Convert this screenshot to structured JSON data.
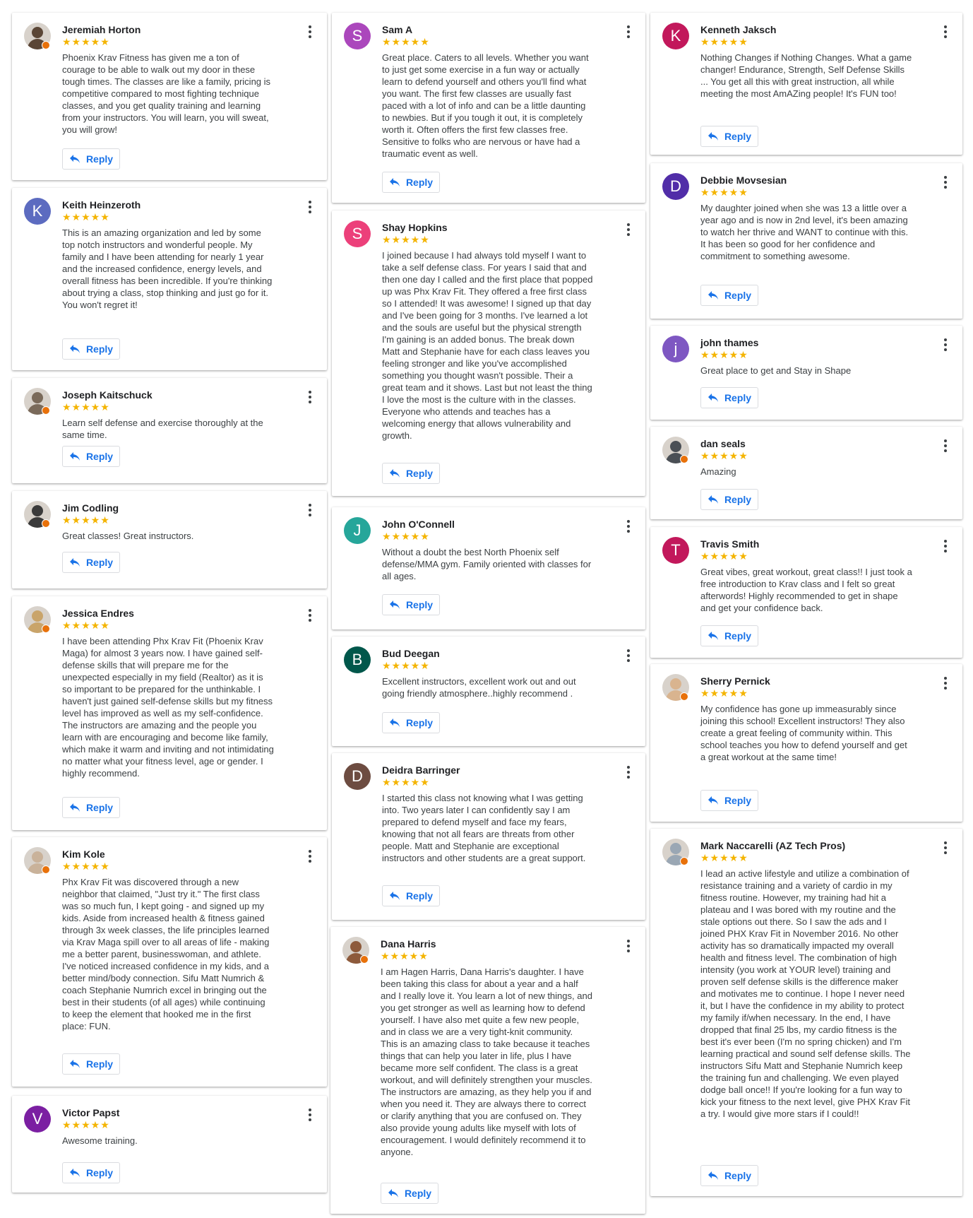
{
  "reviews": [
    {
      "name": "Jeremiah Horton",
      "stars": "★★★★★",
      "avatar_type": "photo",
      "avatar_letter": "",
      "avatar_color": "#5b4636",
      "text": "Phoenix Krav Fitness has given me a ton of courage to be able to walk out my door in these tough times. The classes are like a family, pricing is competitive compared to most fighting technique classes, and you get quality training and learning from your instructors. You will learn, you will sweat, you will grow!",
      "reply": "Reply"
    },
    {
      "name": "Keith Heinzeroth",
      "stars": "★★★★★",
      "avatar_type": "letter",
      "avatar_letter": "K",
      "avatar_color": "#5c6bc0",
      "text": "This is an amazing organization and led by some top notch instructors and wonderful people. My family and I have been attending for nearly 1 year and the increased confidence, energy levels, and overall fitness has been incredible. If you're thinking about trying a class, stop thinking and just go for it. You won't regret it!",
      "reply": "Reply"
    },
    {
      "name": "Joseph Kaitschuck",
      "stars": "★★★★★",
      "avatar_type": "photo",
      "avatar_letter": "",
      "avatar_color": "#7a6a5a",
      "text": "Learn self defense and exercise thoroughly at the same time.",
      "reply": "Reply"
    },
    {
      "name": "Jim Codling",
      "stars": "★★★★★",
      "avatar_type": "photo",
      "avatar_letter": "",
      "avatar_color": "#3b3b3b",
      "text": "Great classes! Great instructors.",
      "reply": "Reply"
    },
    {
      "name": "Jessica Endres",
      "stars": "★★★★★",
      "avatar_type": "photo",
      "avatar_letter": "",
      "avatar_color": "#c9a46a",
      "text": "I have been attending Phx Krav Fit (Phoenix Krav Maga) for almost 3 years now. I have gained self-defense skills that will prepare me for the unexpected especially in my field (Realtor) as it is so important to be prepared for the unthinkable. I haven't just gained self-defense skills but my fitness level has improved as well as my self-confidence. The instructors are amazing and the people you learn with are encouraging and become like family, which make it warm and inviting and not intimidating no matter what your fitness level, age or gender. I highly recommend.",
      "reply": "Reply"
    },
    {
      "name": "Kim Kole",
      "stars": "★★★★★",
      "avatar_type": "photo",
      "avatar_letter": "",
      "avatar_color": "#c9b29a",
      "text": "Phx Krav Fit was discovered through a new neighbor that claimed, \"Just try it.\" The first class was so much fun, I kept going - and signed up my kids. Aside from increased health & fitness gained through 3x week classes, the life principles learned via Krav Maga spill over to all areas of life - making me a better parent, businesswoman, and athlete. I've noticed increased confidence in my kids, and a better mind/body connection. Sifu Matt Numrich & coach Stephanie Numrich excel in bringing out the best in their students (of all ages) while continuing to keep the element that hooked me in the first place: FUN.",
      "reply": "Reply"
    },
    {
      "name": "Victor Papst",
      "stars": "★★★★★",
      "avatar_type": "letter",
      "avatar_letter": "V",
      "avatar_color": "#7b1fa2",
      "text": "Awesome training.",
      "reply": "Reply"
    },
    {
      "name": "Sam A",
      "stars": "★★★★★",
      "avatar_type": "letter",
      "avatar_letter": "S",
      "avatar_color": "#ab47bc",
      "text": "Great place. Caters to all levels. Whether you want to just get some exercise in a fun way or actually learn to defend yourself and others you'll find what you want. The first few classes are usually fast paced with a lot of info and can be a little daunting to newbies. But if you tough it out, it is completely worth it. Often offers the first few classes free. Sensitive to folks who are nervous or have had a traumatic event as well.",
      "reply": "Reply"
    },
    {
      "name": "Shay Hopkins",
      "stars": "★★★★★",
      "avatar_type": "letter",
      "avatar_letter": "S",
      "avatar_color": "#ec407a",
      "text": "I joined because I had always told myself I want to take a self defense class. For years I said that and then one day I called and the first place that popped up was Phx Krav Fit. They offered a free first class so I attended! It was awesome! I signed up that day and I've been going for 3 months. I've learned a lot and the souls are useful but the physical strength I'm gaining is an added bonus. The break down Matt and Stephanie have for each class leaves you feeling stronger and like you've accomplished something you thought wasn't possible. Their a great team and it shows. Last but not least the thing I love the most is the culture with in the classes. Everyone who attends and teaches has a welcoming energy that allows vulnerability and growth.",
      "reply": "Reply"
    },
    {
      "name": "John O'Connell",
      "stars": "★★★★★",
      "avatar_type": "letter",
      "avatar_letter": "J",
      "avatar_color": "#26a69a",
      "text": "Without a doubt the best North Phoenix self defense/MMA gym. Family oriented with classes for all ages.",
      "reply": "Reply"
    },
    {
      "name": "Bud Deegan",
      "stars": "★★★★★",
      "avatar_type": "letter",
      "avatar_letter": "B",
      "avatar_color": "#00574b",
      "text": "Excellent instructors, excellent work out and out going friendly atmosphere..highly recommend .",
      "reply": "Reply"
    },
    {
      "name": "Deidra Barringer",
      "stars": "★★★★★",
      "avatar_type": "letter",
      "avatar_letter": "D",
      "avatar_color": "#6d4c41",
      "text": "I started this class not knowing what I was getting into. Two years later I can confidently say I am prepared to defend myself and face my fears, knowing that not all fears are threats from other people. Matt and Stephanie are exceptional instructors and other students are a great support.",
      "reply": "Reply"
    },
    {
      "name": "Dana Harris",
      "stars": "★★★★★",
      "avatar_type": "photo",
      "avatar_letter": "",
      "avatar_color": "#8d5a3b",
      "text": "I am Hagen Harris, Dana Harris's daughter. I have been taking this class for about a year and a half and I really love it. You learn a lot of new things, and you get stronger as well as learning how to defend yourself. I have also met quite a few new people, and in class we are a very tight-knit community. This is an amazing class to take because it teaches things that can help you later in life, plus I have became more self confident. The class is a great workout, and will definitely strengthen your muscles. The instructors are amazing, as they help you if and when you need it. They are always there to correct or clarify anything that you are confused on. They also provide young adults like myself with lots of encouragement. I would definitely recommend it to anyone.",
      "reply": "Reply"
    },
    {
      "name": "Kenneth Jaksch",
      "stars": "★★★★★",
      "avatar_type": "letter",
      "avatar_letter": "K",
      "avatar_color": "#c2185b",
      "text": "Nothing Changes if Nothing Changes. What a game changer! Endurance, Strength, Self Defense Skills ... You get all this with great instruction, all while meeting the most AmAZing people! It's FUN too!",
      "reply": "Reply"
    },
    {
      "name": "Debbie Movsesian",
      "stars": "★★★★★",
      "avatar_type": "letter",
      "avatar_letter": "D",
      "avatar_color": "#512da8",
      "text": "My daughter joined when she was 13 a little over a year ago and is now in 2nd level, it's been amazing to watch her thrive and WANT to continue with this. It has been so good for her confidence and commitment to something awesome.",
      "reply": "Reply"
    },
    {
      "name": "john thames",
      "stars": "★★★★★",
      "avatar_type": "letter",
      "avatar_letter": "j",
      "avatar_color": "#7e57c2",
      "text": "Great place to get and Stay in Shape",
      "reply": "Reply"
    },
    {
      "name": "dan seals",
      "stars": "★★★★★",
      "avatar_type": "photo",
      "avatar_letter": "",
      "avatar_color": "#4a4f55",
      "text": "Amazing",
      "reply": "Reply"
    },
    {
      "name": "Travis Smith",
      "stars": "★★★★★",
      "avatar_type": "letter",
      "avatar_letter": "T",
      "avatar_color": "#c2185b",
      "text": "Great vibes, great workout, great class!! I just took a free introduction to Krav class and I felt so great afterwords! Highly recommended to get in shape and get your confidence back.",
      "reply": "Reply"
    },
    {
      "name": "Sherry Pernick",
      "stars": "★★★★★",
      "avatar_type": "photo",
      "avatar_letter": "",
      "avatar_color": "#d9b48f",
      "text": "My confidence has gone up immeasurably since joining this school! Excellent instructors! They also create a great feeling of community within. This school teaches you how to defend yourself and get a great workout at the same time!",
      "reply": "Reply"
    },
    {
      "name": "Mark Naccarelli (AZ Tech Pros)",
      "stars": "★★★★★",
      "avatar_type": "photo",
      "avatar_letter": "",
      "avatar_color": "#9aa7b4",
      "text": "I lead an active lifestyle and utilize a combination of resistance training and a variety of cardio in my fitness routine. However, my training had hit a plateau and I was bored with my routine and the stale options out there. So I saw the ads and I joined PHX Krav Fit in November 2016. No other activity has so dramatically impacted my overall health and fitness level. The combination of high intensity (you work at YOUR level) training and proven self defense skills is the difference maker and motivates me to continue. I hope I never need it, but I have the confidence in my ability to protect my family if/when necessary. In the end, I have dropped that final 25 lbs, my cardio fitness is the best it's ever been (I'm no spring chicken) and I'm learning practical and sound self defense skills. The instructors Sifu Matt and Stephanie Numrich keep the training fun and challenging. We even played dodge ball once!! If you're looking for a fun way to kick your fitness to the next level, give PHX Krav Fit a try. I would give more stars if I could!!",
      "reply": "Reply"
    }
  ]
}
